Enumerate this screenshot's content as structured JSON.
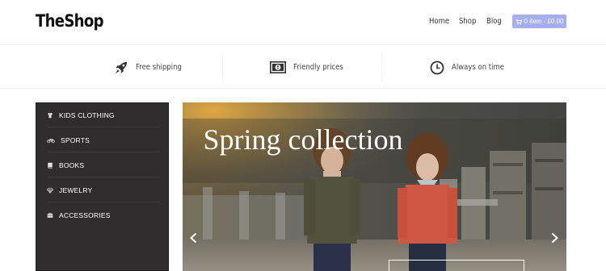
{
  "header": {
    "logo": "TheShop",
    "nav": [
      "Home",
      "Shop",
      "Blog"
    ],
    "cart": {
      "label": "0 item - £0.00",
      "color": "#a7aef0"
    }
  },
  "features": [
    {
      "icon": "rocket-icon",
      "label": "Free shipping"
    },
    {
      "icon": "money-icon",
      "label": "Friendly prices"
    },
    {
      "icon": "clock-icon",
      "label": "Always on time"
    }
  ],
  "sidebar": {
    "items": [
      {
        "icon": "shirt-icon",
        "label": "KIDS CLOTHING"
      },
      {
        "icon": "bicycle-icon",
        "label": "SPORTS"
      },
      {
        "icon": "book-icon",
        "label": "BOOKS"
      },
      {
        "icon": "diamond-icon",
        "label": "JEWELRY"
      },
      {
        "icon": "briefcase-icon",
        "label": "ACCESSORIES"
      }
    ],
    "background": "#2f2c2d"
  },
  "hero": {
    "title": "Spring collection",
    "image": "photo of two children standing on a path"
  }
}
